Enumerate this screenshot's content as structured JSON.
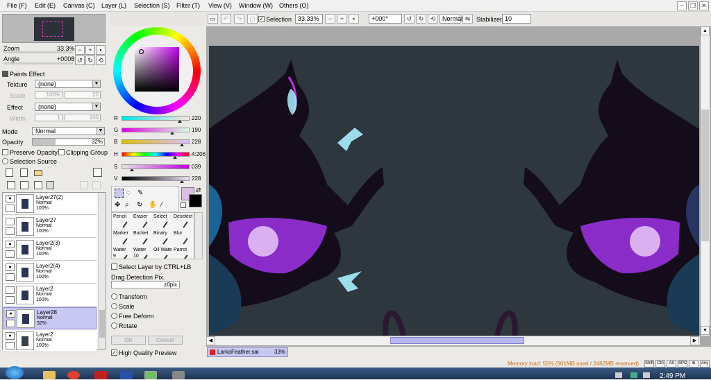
{
  "menu": [
    "File (F)",
    "Edit (E)",
    "Canvas (C)",
    "Layer (L)",
    "Selection (S)",
    "Filter (T)",
    "View (V)",
    "Window (W)",
    "Others (O)"
  ],
  "window_controls": {
    "minimize": "−",
    "restore": "❐",
    "close": "✕"
  },
  "navigator": {
    "zoom_label": "Zoom",
    "zoom_value": "33.3%",
    "angle_label": "Angle",
    "angle_value": "+0008"
  },
  "paints_effect": {
    "title": "Paints Effect",
    "texture_label": "Texture",
    "texture_value": "(none)",
    "scale_label": "Scale",
    "scale_value": "100%",
    "scale_num": "20",
    "effect_label": "Effect",
    "effect_value": "(none)",
    "width_label": "Width",
    "width_value": "1",
    "width_num": "100"
  },
  "layer_props": {
    "mode_label": "Mode",
    "mode_value": "Normal",
    "opacity_label": "Opacity",
    "opacity_value": "32%",
    "opacity_fraction": 0.32,
    "preserve_opacity": "Preserve Opacity",
    "clipping_group": "Clipping Group",
    "selection_source": "Selection Source"
  },
  "layers": [
    {
      "name": "Layer27(2)",
      "mode": "Normal",
      "opacity": "100%",
      "visible": true,
      "selected": false
    },
    {
      "name": "Layer27",
      "mode": "Normal",
      "opacity": "100%",
      "visible": false,
      "selected": false
    },
    {
      "name": "Layer2(3)",
      "mode": "Normal",
      "opacity": "100%",
      "visible": true,
      "selected": false
    },
    {
      "name": "Layer2(4)",
      "mode": "Normal",
      "opacity": "100%",
      "visible": true,
      "selected": false
    },
    {
      "name": "Layer2",
      "mode": "Normal",
      "opacity": "100%",
      "visible": false,
      "selected": false
    },
    {
      "name": "Layer28",
      "mode": "Normal",
      "opacity": "32%",
      "visible": true,
      "selected": true
    },
    {
      "name": "Layer2",
      "mode": "Normal",
      "opacity": "100%",
      "visible": true,
      "selected": false
    }
  ],
  "color_sliders": [
    {
      "label": "R",
      "value": "220",
      "fraction": 0.863,
      "gradient": "linear-gradient(90deg,#00e4e4,#ffe4e4)"
    },
    {
      "label": "G",
      "value": "190",
      "fraction": 0.745,
      "gradient": "linear-gradient(90deg,#dc00e4,#dcffe4)"
    },
    {
      "label": "B",
      "value": "228",
      "fraction": 0.894,
      "gradient": "linear-gradient(90deg,#dcbe00,#dcbeff)"
    },
    {
      "label": "H",
      "value": "4:206",
      "fraction": 0.79,
      "gradient": "linear-gradient(90deg,#f00,#ff0,#0f0,#0ff,#00f,#f0f,#f00)"
    },
    {
      "label": "S",
      "value": "039",
      "fraction": 0.15,
      "gradient": "linear-gradient(90deg,#e4e4e4,#c000e4)"
    },
    {
      "label": "V",
      "value": "228",
      "fraction": 0.894,
      "gradient": "linear-gradient(90deg,#000,#ecdcf4)"
    }
  ],
  "colors": {
    "foreground": "#dcbee4",
    "background": "#000000",
    "canvas_bg": "#2e363e",
    "accent": "#c8c8f2"
  },
  "tools": [
    {
      "label": "Pencil",
      "icon": "pencil-icon"
    },
    {
      "label": "Eraser",
      "icon": "eraser-icon"
    },
    {
      "label": "Select",
      "icon": "select-icon"
    },
    {
      "label": "Deselect",
      "icon": "deselect-icon"
    },
    {
      "label": "Marker",
      "icon": "marker-icon"
    },
    {
      "label": "Bucket",
      "icon": "bucket-icon"
    },
    {
      "label": "Binary",
      "icon": "binary-icon"
    },
    {
      "label": "Blur",
      "icon": "blur-icon"
    },
    {
      "label": "Water",
      "icon": "water-icon"
    },
    {
      "label": "Water",
      "icon": "water-icon"
    },
    {
      "label": "Oil Wate",
      "icon": "oil-water-icon"
    },
    {
      "label": "Parrot",
      "icon": "parrot-icon"
    }
  ],
  "tool_numbers": {
    "first": "9",
    "second": "10"
  },
  "options": {
    "select_layer": "Select Layer by CTRL+LB",
    "drag_detection": "Drag Detection Pix.",
    "drag_value": "±0pix",
    "transform": "Transform",
    "scale": "Scale",
    "free_deform": "Free Deform",
    "rotate": "Rotate",
    "ok": "OK",
    "cancel": "Cancel",
    "high_quality": "High Quality Preview"
  },
  "toolbar": {
    "selection_label": "Selection",
    "zoom": "33.33%",
    "rotation": "+000°",
    "blend": "Normal",
    "stabilizer_label": "Stabilizer",
    "stabilizer_value": "10"
  },
  "document": {
    "name": "LarkaFeather.sai",
    "zoom": "33%"
  },
  "status": {
    "memory": "Memory load: 55% (901MB used / 2482MB reserved)",
    "keys": [
      "Shift",
      "Ctrl",
      "Alt",
      "SPC",
      "⊕",
      "Any"
    ]
  },
  "taskbar": {
    "time": "2:49 PM"
  }
}
